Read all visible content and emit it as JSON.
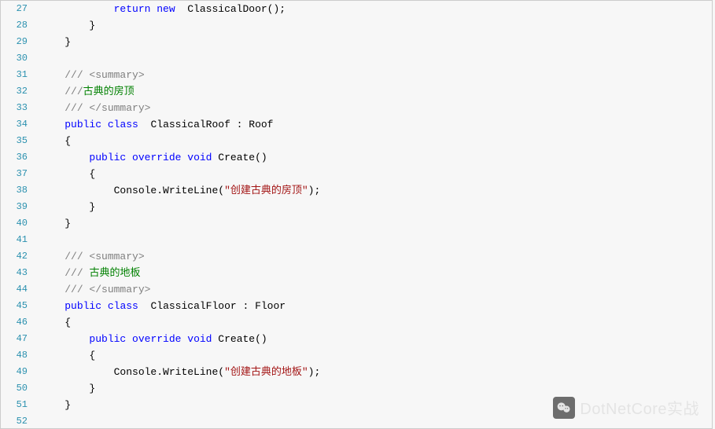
{
  "watermark": {
    "text": "DotNetCore实战"
  },
  "syntax": {
    "kw_return": "return",
    "kw_new": "new",
    "kw_public": "public",
    "kw_class": "class",
    "kw_override": "override",
    "kw_void": "void"
  },
  "lines": [
    {
      "n": "27",
      "indent": "            ",
      "tokens": [
        {
          "c": "kw",
          "b": "syntax.kw_return"
        },
        {
          "c": "pn",
          "t": " "
        },
        {
          "c": "kw",
          "b": "syntax.kw_new"
        },
        {
          "c": "pn",
          "t": "  ClassicalDoor();"
        }
      ]
    },
    {
      "n": "28",
      "indent": "        ",
      "tokens": [
        {
          "c": "pn",
          "t": "}"
        }
      ]
    },
    {
      "n": "29",
      "indent": "    ",
      "tokens": [
        {
          "c": "pn",
          "t": "}"
        }
      ]
    },
    {
      "n": "30",
      "indent": "",
      "tokens": []
    },
    {
      "n": "31",
      "indent": "    ",
      "tokens": [
        {
          "c": "cm",
          "t": "/// <summary>"
        }
      ]
    },
    {
      "n": "32",
      "indent": "    ",
      "tokens": [
        {
          "c": "cm",
          "t": "///"
        },
        {
          "c": "cg",
          "t": "古典的房顶"
        }
      ]
    },
    {
      "n": "33",
      "indent": "    ",
      "tokens": [
        {
          "c": "cm",
          "t": "/// </summary>"
        }
      ]
    },
    {
      "n": "34",
      "indent": "    ",
      "tokens": [
        {
          "c": "kw",
          "b": "syntax.kw_public"
        },
        {
          "c": "pn",
          "t": " "
        },
        {
          "c": "kw",
          "b": "syntax.kw_class"
        },
        {
          "c": "pn",
          "t": "  ClassicalRoof : Roof"
        }
      ]
    },
    {
      "n": "35",
      "indent": "    ",
      "tokens": [
        {
          "c": "pn",
          "t": "{"
        }
      ]
    },
    {
      "n": "36",
      "indent": "        ",
      "tokens": [
        {
          "c": "kw",
          "b": "syntax.kw_public"
        },
        {
          "c": "pn",
          "t": " "
        },
        {
          "c": "kw",
          "b": "syntax.kw_override"
        },
        {
          "c": "pn",
          "t": " "
        },
        {
          "c": "kw",
          "b": "syntax.kw_void"
        },
        {
          "c": "pn",
          "t": " Create()"
        }
      ]
    },
    {
      "n": "37",
      "indent": "        ",
      "tokens": [
        {
          "c": "pn",
          "t": "{"
        }
      ]
    },
    {
      "n": "38",
      "indent": "            ",
      "tokens": [
        {
          "c": "pn",
          "t": "Console.WriteLine("
        },
        {
          "c": "str",
          "t": "\"创建古典的房顶\""
        },
        {
          "c": "pn",
          "t": ");"
        }
      ]
    },
    {
      "n": "39",
      "indent": "        ",
      "tokens": [
        {
          "c": "pn",
          "t": "}"
        }
      ]
    },
    {
      "n": "40",
      "indent": "    ",
      "tokens": [
        {
          "c": "pn",
          "t": "}"
        }
      ]
    },
    {
      "n": "41",
      "indent": "",
      "tokens": []
    },
    {
      "n": "42",
      "indent": "    ",
      "tokens": [
        {
          "c": "cm",
          "t": "/// <summary>"
        }
      ]
    },
    {
      "n": "43",
      "indent": "    ",
      "tokens": [
        {
          "c": "cm",
          "t": "/// "
        },
        {
          "c": "cg",
          "t": "古典的地板"
        }
      ]
    },
    {
      "n": "44",
      "indent": "    ",
      "tokens": [
        {
          "c": "cm",
          "t": "/// </summary>"
        }
      ]
    },
    {
      "n": "45",
      "indent": "    ",
      "tokens": [
        {
          "c": "kw",
          "b": "syntax.kw_public"
        },
        {
          "c": "pn",
          "t": " "
        },
        {
          "c": "kw",
          "b": "syntax.kw_class"
        },
        {
          "c": "pn",
          "t": "  ClassicalFloor : Floor"
        }
      ]
    },
    {
      "n": "46",
      "indent": "    ",
      "tokens": [
        {
          "c": "pn",
          "t": "{"
        }
      ]
    },
    {
      "n": "47",
      "indent": "        ",
      "tokens": [
        {
          "c": "kw",
          "b": "syntax.kw_public"
        },
        {
          "c": "pn",
          "t": " "
        },
        {
          "c": "kw",
          "b": "syntax.kw_override"
        },
        {
          "c": "pn",
          "t": " "
        },
        {
          "c": "kw",
          "b": "syntax.kw_void"
        },
        {
          "c": "pn",
          "t": " Create()"
        }
      ]
    },
    {
      "n": "48",
      "indent": "        ",
      "tokens": [
        {
          "c": "pn",
          "t": "{"
        }
      ]
    },
    {
      "n": "49",
      "indent": "            ",
      "tokens": [
        {
          "c": "pn",
          "t": "Console.WriteLine("
        },
        {
          "c": "str",
          "t": "\"创建古典的地板\""
        },
        {
          "c": "pn",
          "t": ");"
        }
      ]
    },
    {
      "n": "50",
      "indent": "        ",
      "tokens": [
        {
          "c": "pn",
          "t": "}"
        }
      ]
    },
    {
      "n": "51",
      "indent": "    ",
      "tokens": [
        {
          "c": "pn",
          "t": "}"
        }
      ]
    },
    {
      "n": "52",
      "indent": "",
      "tokens": []
    }
  ]
}
